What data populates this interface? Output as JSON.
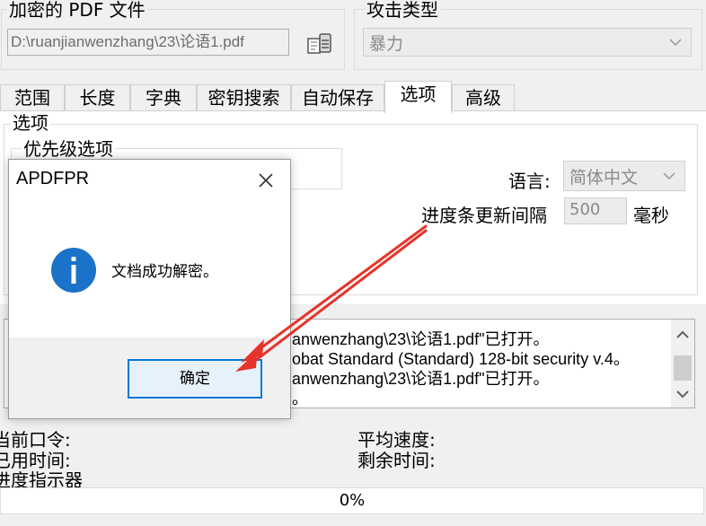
{
  "encrypted_file": {
    "group_title": "加密的 PDF 文件",
    "path_value": "D:\\ruanjianwenzhang\\23\\论语1.pdf",
    "open_icon": "open-file-icon"
  },
  "attack_type": {
    "group_title": "攻击类型",
    "selected": "暴力"
  },
  "tabs": [
    {
      "label": "范围"
    },
    {
      "label": "长度"
    },
    {
      "label": "字典"
    },
    {
      "label": "密钥搜索"
    },
    {
      "label": "自动保存"
    },
    {
      "label": "选项",
      "active": true
    },
    {
      "label": "高级"
    }
  ],
  "options": {
    "group_title": "选项",
    "priority_title": "优先级选项",
    "language_label": "语言:",
    "language_value": "简体中文",
    "progress_interval_label": "进度条更新间隔",
    "progress_interval_value": "500",
    "progress_interval_unit": "毫秒"
  },
  "log": {
    "lines": [
      "anwenzhang\\23\\论语1.pdf\"已打开。",
      "obat Standard (Standard) 128-bit security v.4。",
      "anwenzhang\\23\\论语1.pdf\"已打开。",
      "。"
    ]
  },
  "status": {
    "current_password": "当前口令:",
    "elapsed_time": "已用时间:",
    "progress_indicator": "进度指示器",
    "avg_speed": "平均速度:",
    "remaining_time": "剩余时间:"
  },
  "progress": {
    "percent": 0,
    "label": "0%"
  },
  "dialog": {
    "title": "APDFPR",
    "message": "文档成功解密。",
    "ok_label": "确定",
    "icon": "info-icon"
  },
  "colors": {
    "accent": "#0078d7",
    "info_icon": "#1a73c8",
    "annotation_arrow": "#e8332a"
  }
}
